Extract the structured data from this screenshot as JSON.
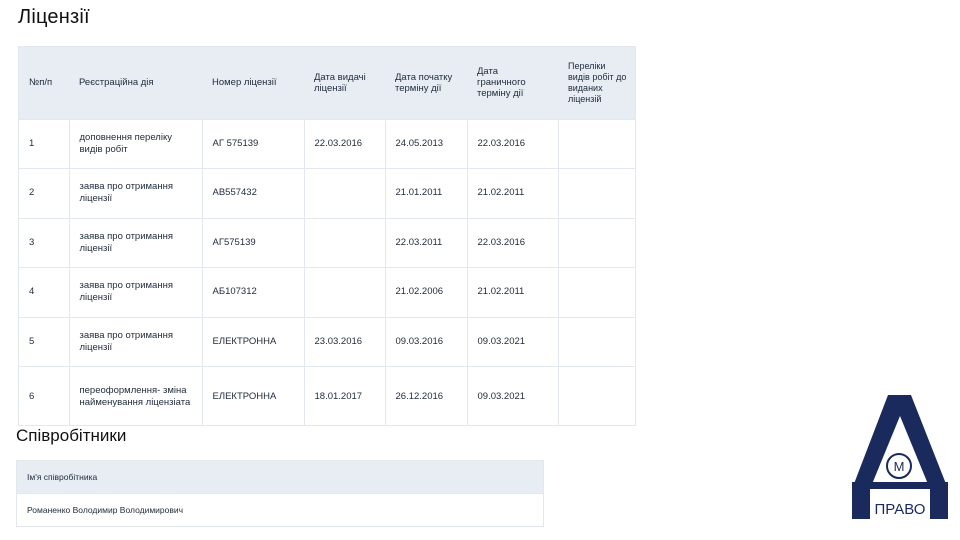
{
  "licenses_title": "Ліцензії",
  "employees_title": "Співробітники",
  "licenses_table": {
    "columns": [
      "№п/п",
      "Реєстраційна дія",
      "Номер ліцензії",
      "Дата видачі ліцензії",
      "Дата початку терміну дії",
      "Дата граничного терміну дії",
      "Переліки видів робіт до виданих ліцензій"
    ],
    "rows": [
      [
        "1",
        "доповнення переліку видів робіт",
        "АГ 575139",
        "22.03.2016",
        "24.05.2013",
        "22.03.2016",
        ""
      ],
      [
        "2",
        "заява про отримання ліцензії",
        "АВ557432",
        "",
        "21.01.2011",
        "21.02.2011",
        ""
      ],
      [
        "3",
        "заява про отримання ліцензії",
        "АГ575139",
        "",
        "22.03.2011",
        "22.03.2016",
        ""
      ],
      [
        "4",
        "заява про отримання ліцензії",
        "АБ107312",
        "",
        "21.02.2006",
        "21.02.2011",
        ""
      ],
      [
        "5",
        "заява про отримання ліцензії",
        "ЕЛЕКТРОННА",
        "23.03.2016",
        "09.03.2016",
        "09.03.2021",
        ""
      ],
      [
        "6",
        "переоформлення- зміна найменування ліцензіата",
        "ЕЛЕКТРОННА",
        "18.01.2017",
        "26.12.2016",
        "09.03.2021",
        ""
      ]
    ]
  },
  "employees_table": {
    "header": "Ім'я співробітника",
    "rows": [
      "Романенко Володимир Володимирович"
    ]
  },
  "logo": {
    "text": "ПРАВО",
    "color": "#1b2a5c"
  }
}
